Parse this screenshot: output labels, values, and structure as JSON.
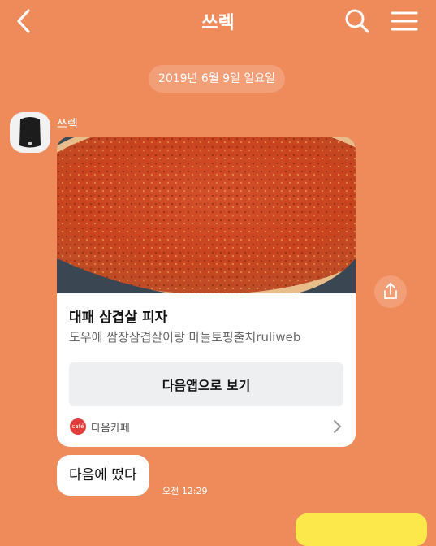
{
  "header": {
    "title": "쓰렉",
    "back_icon": "chevron-left-icon",
    "search_icon": "search-icon",
    "menu_icon": "hamburger-menu-icon"
  },
  "date_divider": "2019년 6월 9일 일요일",
  "message": {
    "sender": "쓰렉",
    "card": {
      "image": "pizza-photo",
      "title": "대패 삼겹살 피자",
      "description": "도우에 쌈장삼겹살이랑 마늘토핑출처ruliweb",
      "button_label": "다음앱으로 보기",
      "source_name": "다음카페",
      "source_logo_text": "café"
    },
    "share_icon": "share-icon",
    "text": "다음에 떴다",
    "time": "오전 12:29"
  },
  "colors": {
    "background": "#ef8a5b",
    "bubble": "#ffffff",
    "my_bubble": "#fde84b",
    "cafe_logo": "#e23b3b"
  }
}
